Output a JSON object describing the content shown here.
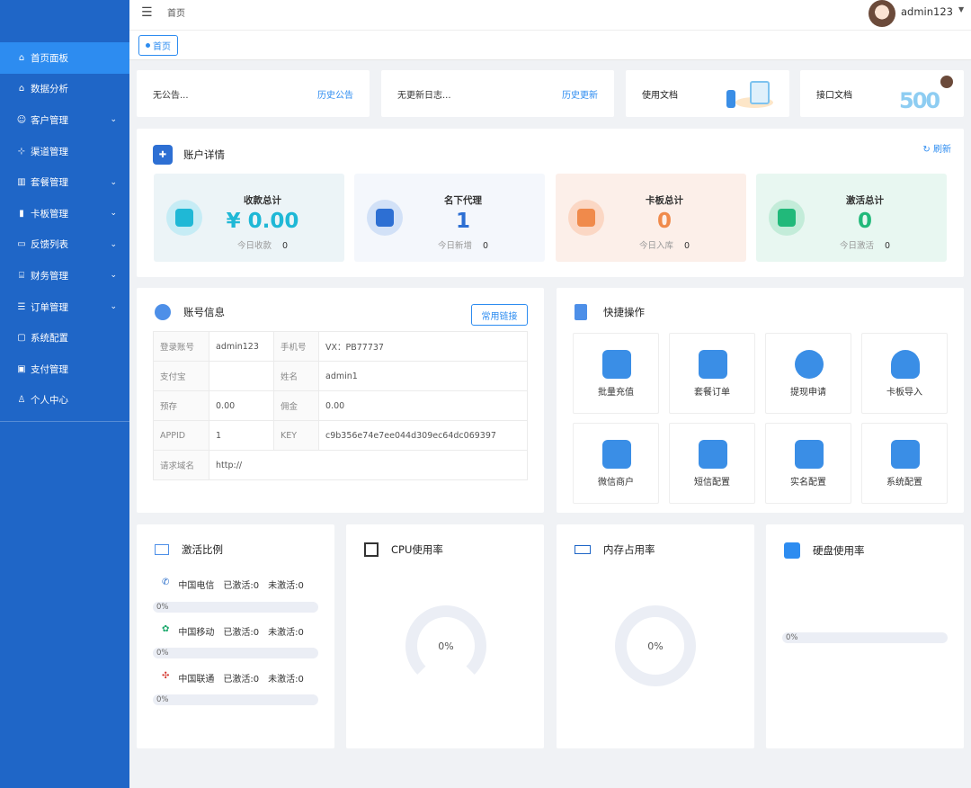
{
  "sidebar": {
    "items": [
      {
        "label": "首页面板",
        "icon": "home-icon",
        "active": true
      },
      {
        "label": "数据分析",
        "icon": "home-icon"
      },
      {
        "label": "客户管理",
        "icon": "users-icon",
        "expandable": true
      },
      {
        "label": "渠道管理",
        "icon": "sitemap-icon"
      },
      {
        "label": "套餐管理",
        "icon": "book-icon",
        "expandable": true
      },
      {
        "label": "卡板管理",
        "icon": "sim-card-icon",
        "expandable": true
      },
      {
        "label": "反馈列表",
        "icon": "message-icon",
        "expandable": true
      },
      {
        "label": "财务管理",
        "icon": "bank-icon",
        "expandable": true
      },
      {
        "label": "订单管理",
        "icon": "list-icon",
        "expandable": true
      },
      {
        "label": "系统配置",
        "icon": "monitor-icon"
      },
      {
        "label": "支付管理",
        "icon": "payment-icon"
      },
      {
        "label": "个人中心",
        "icon": "user-icon"
      }
    ]
  },
  "topbar": {
    "breadcrumb": "首页",
    "username": "admin123"
  },
  "tabs": [
    {
      "label": "首页"
    }
  ],
  "notices": {
    "announcement_text": "无公告...",
    "announcement_link": "历史公告",
    "update_text": "无更新日志...",
    "update_link": "历史更新",
    "docs_label": "使用文档",
    "api_label": "接口文档"
  },
  "account": {
    "title": "账户详情",
    "refresh": "刷新",
    "stats": [
      {
        "label": "收款总计",
        "value": "¥ 0.00",
        "sub_label": "今日收款",
        "sub_value": "0",
        "color": "#1fb8d6"
      },
      {
        "label": "名下代理",
        "value": "1",
        "sub_label": "今日新增",
        "sub_value": "0",
        "color": "#2d6fd3"
      },
      {
        "label": "卡板总计",
        "value": "0",
        "sub_label": "今日入库",
        "sub_value": "0",
        "color": "#f08a4b"
      },
      {
        "label": "激活总计",
        "value": "0",
        "sub_label": "今日激活",
        "sub_value": "0",
        "color": "#21b97a"
      }
    ]
  },
  "info": {
    "title": "账号信息",
    "button": "常用链接",
    "rows": [
      [
        "登录账号",
        "admin123",
        "手机号",
        "VX：PB77737"
      ],
      [
        "支付宝",
        "",
        "姓名",
        "admin1"
      ],
      [
        "预存",
        "0.00",
        "佣金",
        "0.00"
      ],
      [
        "APPID",
        "1",
        "KEY",
        "c9b356e74e7ee044d309ec64dc069397"
      ],
      [
        "请求域名",
        "http://",
        "",
        ""
      ]
    ]
  },
  "quick": {
    "title": "快捷操作",
    "items": [
      {
        "label": "批量充值",
        "icon": "printer-icon"
      },
      {
        "label": "套餐订单",
        "icon": "clipboard-icon"
      },
      {
        "label": "提现申请",
        "icon": "withdraw-icon"
      },
      {
        "label": "卡板导入",
        "icon": "cloud-upload-icon"
      },
      {
        "label": "微信商户",
        "icon": "merchant-icon"
      },
      {
        "label": "短信配置",
        "icon": "envelope-icon"
      },
      {
        "label": "实名配置",
        "icon": "id-card-icon"
      },
      {
        "label": "系统配置",
        "icon": "computer-icon"
      }
    ]
  },
  "activation": {
    "title": "激活比例",
    "carriers": [
      {
        "name": "中国电信",
        "activated": "已激活:0",
        "inactive": "未激活:0",
        "percent": "0%"
      },
      {
        "name": "中国移动",
        "activated": "已激活:0",
        "inactive": "未激活:0",
        "percent": "0%"
      },
      {
        "name": "中国联通",
        "activated": "已激活:0",
        "inactive": "未激活:0",
        "percent": "0%"
      }
    ]
  },
  "cpu": {
    "title": "CPU使用率",
    "value": "0%"
  },
  "memory": {
    "title": "内存占用率",
    "value": "0%"
  },
  "disk": {
    "title": "硬盘使用率",
    "value": "0%"
  }
}
